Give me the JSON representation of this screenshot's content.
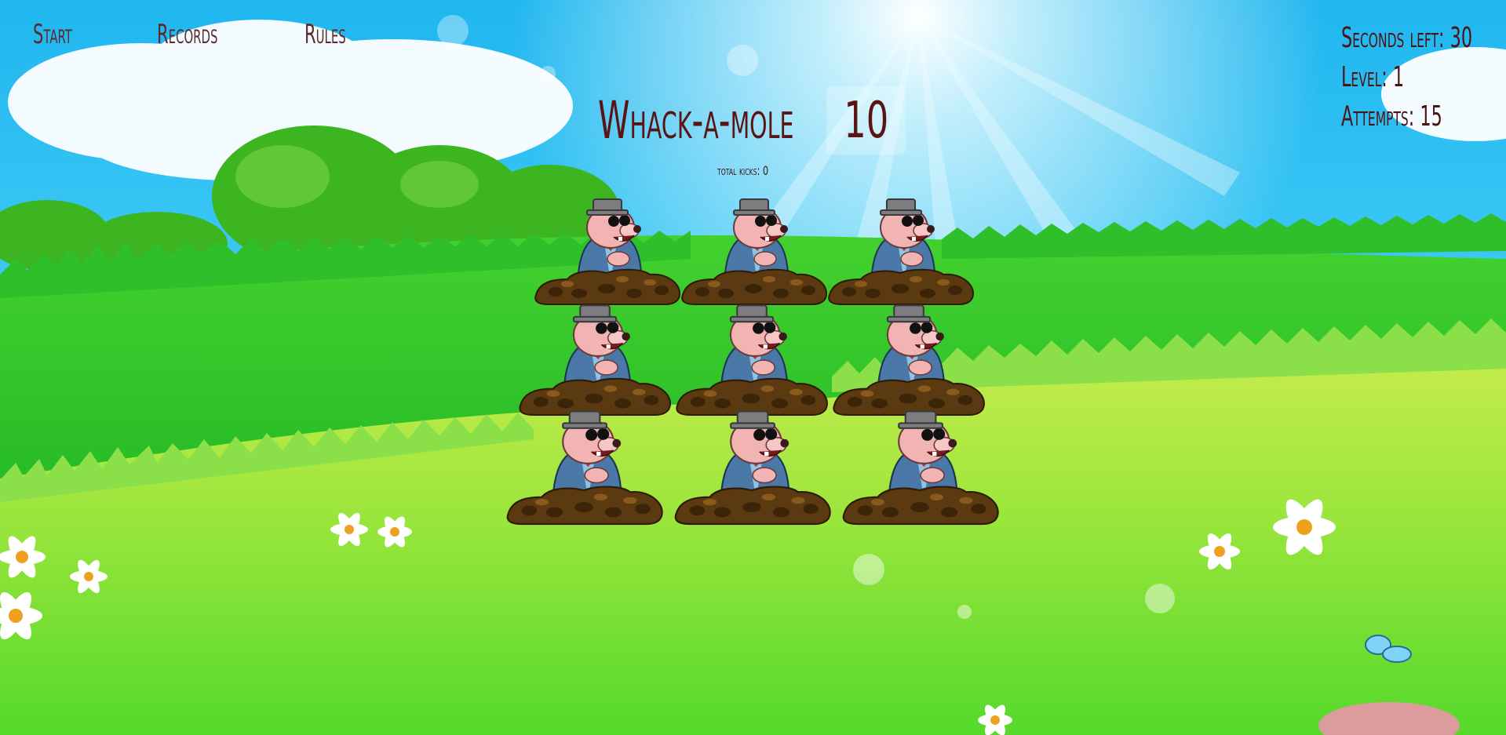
{
  "nav": {
    "start": "Start",
    "records": "Records",
    "rules": "Rules"
  },
  "game": {
    "title": "Whack-a-mole",
    "score": "10",
    "total_kicks_label": "total kicks:",
    "total_kicks_value": "0"
  },
  "stats": {
    "seconds_label": "Seconds left:",
    "seconds_value": "30",
    "level_label": "Level:",
    "level_value": "1",
    "attempts_label": "Attempts:",
    "attempts_value": "15"
  },
  "board": {
    "rows": 3,
    "cols": 3,
    "holes": [
      "mole",
      "mole",
      "mole",
      "mole",
      "mole",
      "mole",
      "mole",
      "mole",
      "mole"
    ]
  },
  "colors": {
    "sky": "#2ec9f2",
    "grass": "#55d63a",
    "dirt": "#5b3a12",
    "title": "#5a1414",
    "mole_coat": "#4a79a8"
  }
}
